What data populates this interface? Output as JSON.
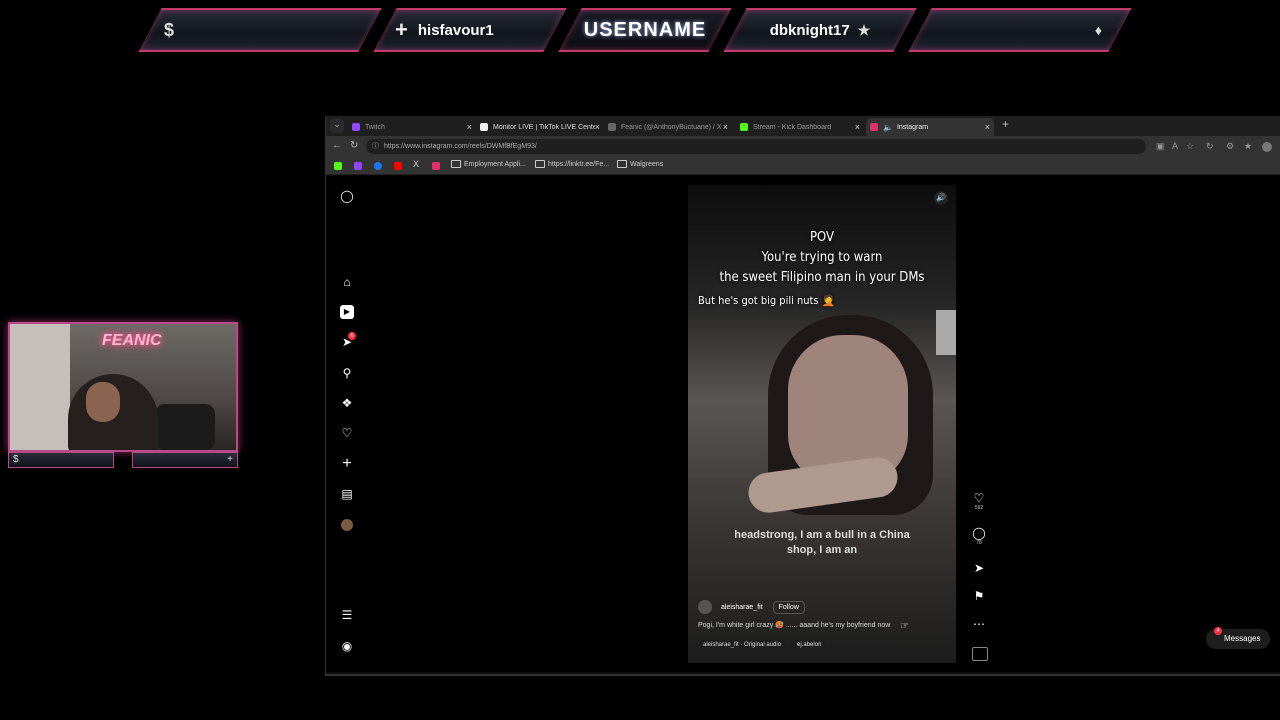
{
  "overlay": {
    "logo_glyph": "$",
    "follower_plus": "+",
    "latest_follower": "hisfavour1",
    "title": "USERNAME",
    "latest_sub": "dbknight17",
    "sub_star": "★",
    "right_icon": "♦",
    "accent_color": "#c23a6c"
  },
  "webcam": {
    "neon_sign": "FEANIC",
    "bar_left": "$",
    "bar_right": "+"
  },
  "browser": {
    "tabs": [
      {
        "label": "Twitch",
        "color": "#9146ff"
      },
      {
        "label": "Monitor LIVE | TikTok LIVE Center",
        "color": "#111111"
      },
      {
        "label": "Feanic (@AnthonyBuctuane) / X",
        "color": "#333333"
      },
      {
        "label": "Stream - Kick Dashboard",
        "color": "#53fc18"
      },
      {
        "label": "Instagram",
        "color": "#e1306c"
      }
    ],
    "new_tab": "+",
    "url": "https://www.instagram.com/reels/DWMfBfEgM93/",
    "bookmarks": [
      {
        "label": "Employment Appli..."
      },
      {
        "label": "https://linktr.ee/Fe..."
      },
      {
        "label": "Walgreens"
      }
    ]
  },
  "instagram": {
    "reel": {
      "caption_lines": [
        "POV",
        "You're trying to warn",
        "the sweet Filipino man in your DMs",
        "But he's got big pili nuts 🤦"
      ],
      "subtitle": "headstrong, I am a bull in a China shop, I am an",
      "username": "aleisharae_fit",
      "follow_label": "Follow",
      "caption": "Pogi, I'm white girl crazy 🥵 ...... aaand he's my boyfriend now",
      "audio": "aleisharae_fit · Original audio",
      "tagged": "ej.abelon"
    },
    "actions": {
      "likes": "592",
      "comments": "78"
    },
    "notification_count": "6",
    "messages_label": "Messages",
    "messages_badge": "4"
  }
}
